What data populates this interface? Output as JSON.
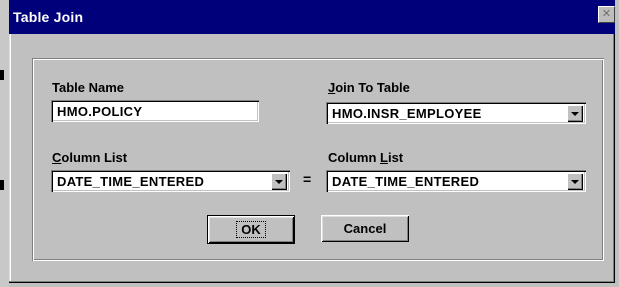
{
  "window": {
    "title": "Table Join",
    "close_glyph": "✕"
  },
  "form": {
    "table_name_label": "Table Name",
    "table_name_value": "HMO.POLICY",
    "join_to_table_label_accel": "J",
    "join_to_table_label_rest": "oin To Table",
    "join_to_table_value": "HMO.INSR_EMPLOYEE",
    "left_column_label_accel": "C",
    "left_column_label_rest": "olumn List",
    "left_column_value": "DATE_TIME_ENTERED",
    "equals_sign": "=",
    "right_column_label_start": "Column ",
    "right_column_label_accel": "L",
    "right_column_label_rest": "ist",
    "right_column_value": "DATE_TIME_ENTERED"
  },
  "buttons": {
    "ok_label": "OK",
    "cancel_label": "Cancel"
  },
  "colors": {
    "titlebar": "#00007a",
    "face": "#c0c0c0"
  }
}
